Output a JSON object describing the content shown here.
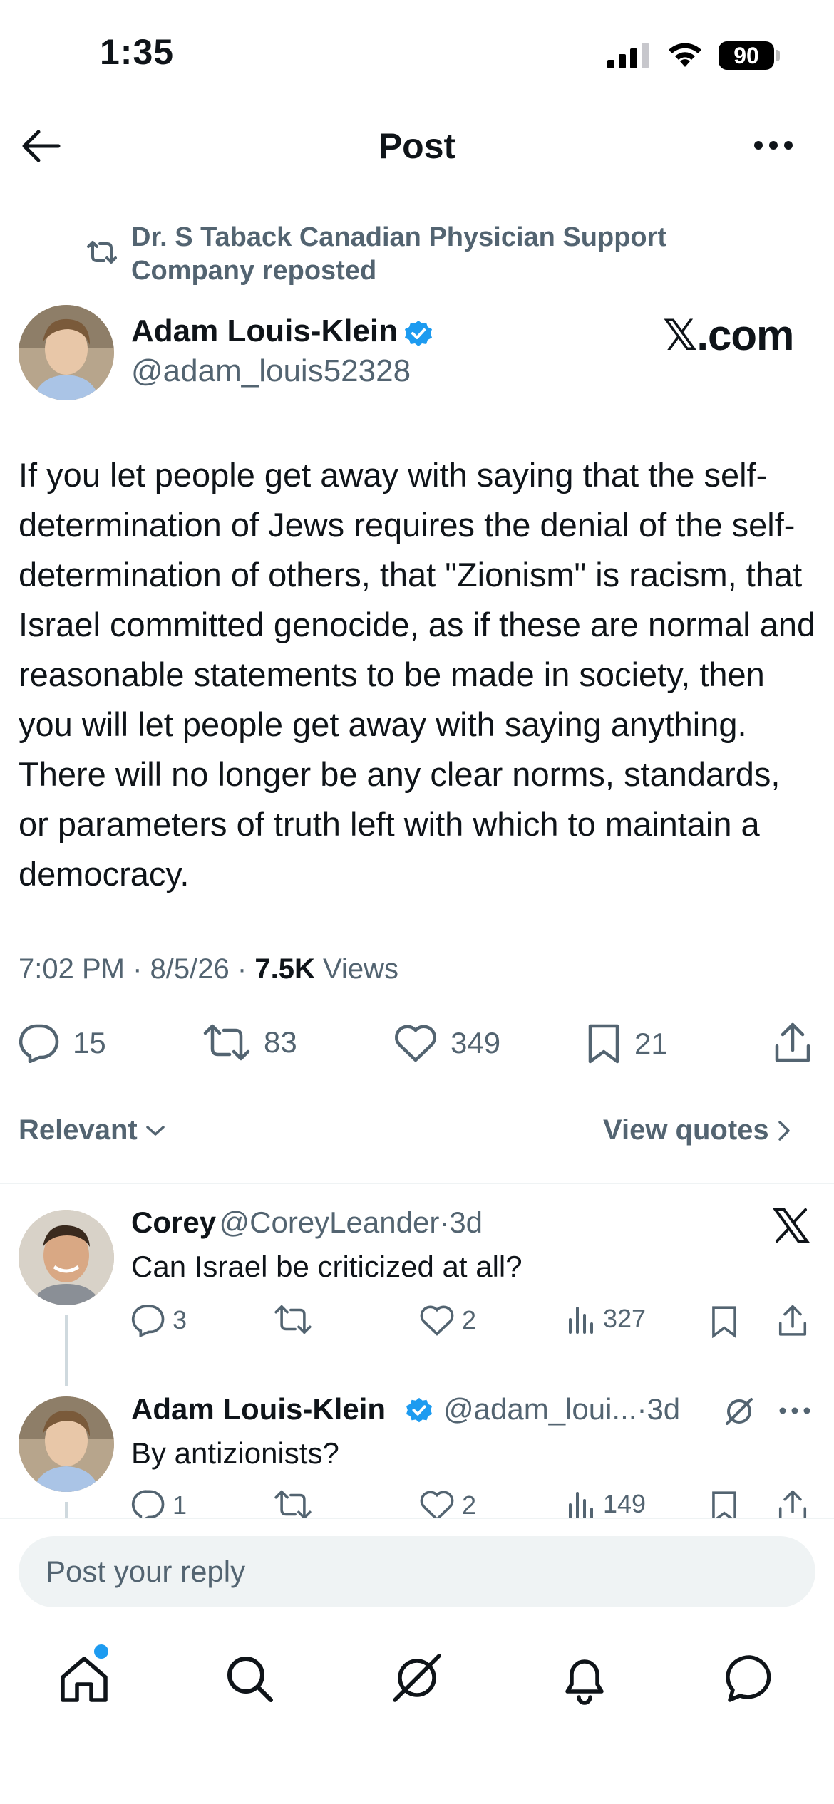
{
  "status_bar": {
    "time": "1:35",
    "battery": "90"
  },
  "header": {
    "title": "Post"
  },
  "repost": {
    "text": "Dr. S Taback Canadian Physician Support Company reposted"
  },
  "post": {
    "author_name": "Adam Louis-Klein",
    "author_handle": "@adam_louis52328",
    "watermark": "𝕏.com",
    "body": "If you let people get away with saying that the self-determination of Jews requires the denial of the self-determination of others, that \"Zionism\" is racism, that Israel committed genocide, as if these are normal and reasonable statements to be made in society, then you will let people get away with saying anything. There will no longer be any clear norms, standards, or parameters of truth left with which to maintain a democracy.",
    "time": "7:02 PM",
    "date": "8/5/26",
    "views_count": "7.5K",
    "views_label": "Views",
    "sep": "·",
    "replies": "15",
    "reposts": "83",
    "likes": "349",
    "bookmarks": "21"
  },
  "filters": {
    "relevant": "Relevant",
    "view_quotes": "View quotes"
  },
  "replies": [
    {
      "name": "Corey",
      "handle": "@CoreyLeander",
      "time": "3d",
      "sep": "·",
      "text": "Can Israel be criticized at all?",
      "replies": "3",
      "reposts": "",
      "likes": "2",
      "views": "327"
    },
    {
      "name": "Adam Louis-Klein",
      "handle": "@adam_loui...",
      "time": "3d",
      "sep": "·",
      "text": "By antizionists?",
      "replies": "1",
      "reposts": "",
      "likes": "2",
      "views": "149"
    }
  ],
  "reply_input": {
    "placeholder": "Post your reply"
  },
  "colors": {
    "verified": "#1d9bf0",
    "secondary": "#536471",
    "notification_dot": "#1d9bf0"
  },
  "icons": [
    "back-arrow-icon",
    "more-icon",
    "repost-icon",
    "verified-icon",
    "reply-icon",
    "like-icon",
    "bookmark-icon",
    "share-icon",
    "chevron-down-icon",
    "chevron-right-icon",
    "x-logo-icon",
    "views-icon",
    "grok-icon",
    "home-icon",
    "search-icon",
    "bell-icon",
    "messages-icon"
  ]
}
